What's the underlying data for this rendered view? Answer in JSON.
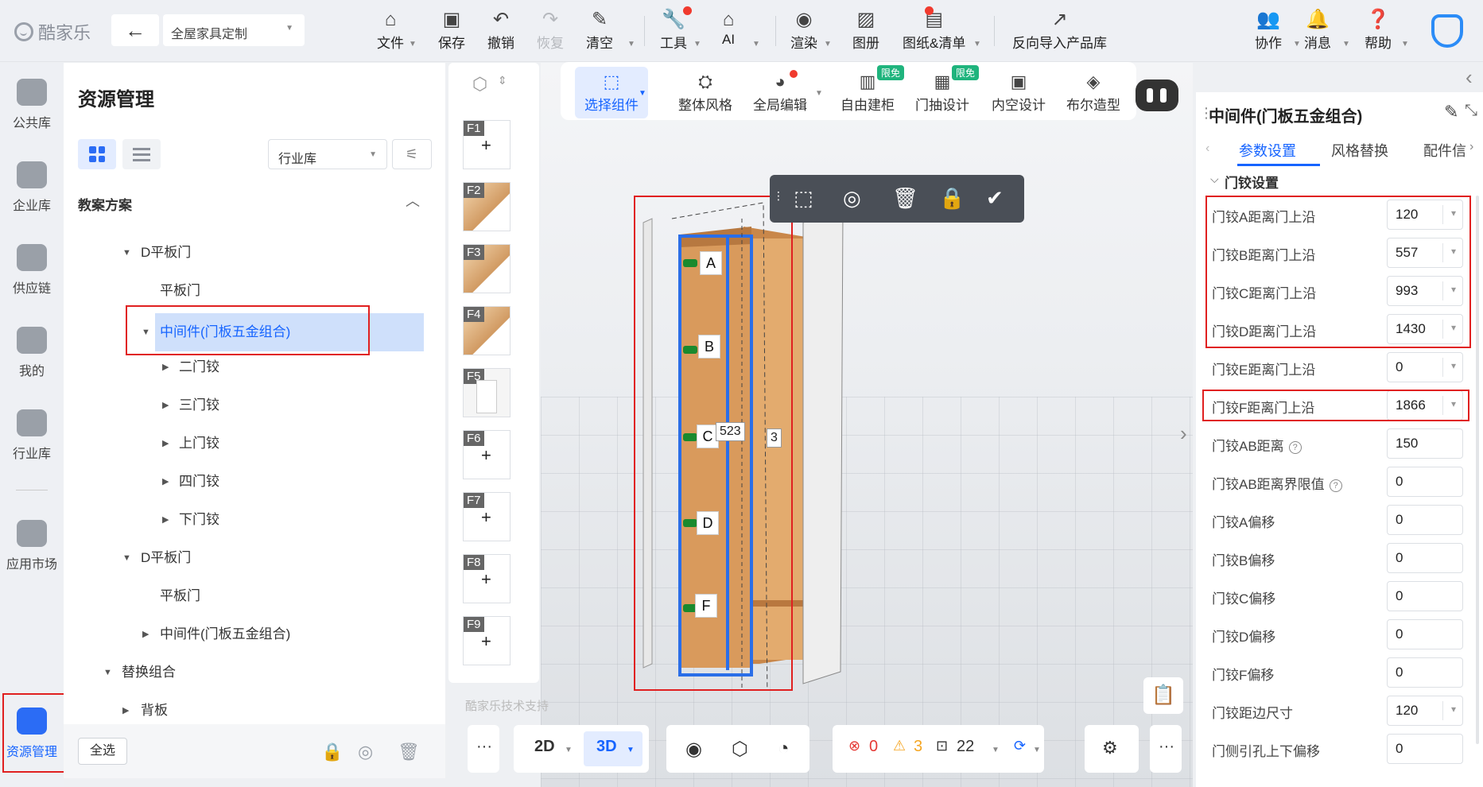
{
  "app": {
    "logo_text": "酷家乐",
    "project_name": "全屋家具定制"
  },
  "toolbar": {
    "file": "文件",
    "save": "保存",
    "undo": "撤销",
    "redo": "恢复",
    "clear": "清空",
    "tools": "工具",
    "ai": "AI",
    "render": "渲染",
    "album": "图册",
    "drawings": "图纸&清单",
    "reverse_import": "反向导入产品库",
    "collab": "协作",
    "message": "消息",
    "help": "帮助"
  },
  "left_nav": [
    "公共库",
    "企业库",
    "供应链",
    "我的",
    "行业库",
    "应用市场",
    "资源管理"
  ],
  "resource_panel": {
    "title": "资源管理",
    "library_select": "行业库",
    "section": "教案方案",
    "tree": [
      {
        "label": "D平板门"
      },
      {
        "label": "平板门"
      },
      {
        "label": "中间件(门板五金组合)"
      },
      {
        "label": "二门铰"
      },
      {
        "label": "三门铰"
      },
      {
        "label": "上门铰"
      },
      {
        "label": "四门铰"
      },
      {
        "label": "下门铰"
      },
      {
        "label": "D平板门"
      },
      {
        "label": "平板门"
      },
      {
        "label": "中间件(门板五金组合)"
      },
      {
        "label": "替换组合"
      },
      {
        "label": "背板"
      }
    ],
    "select_all": "全选"
  },
  "thumbs": [
    "F1",
    "F2",
    "F3",
    "F4",
    "F5",
    "F6",
    "F7",
    "F8",
    "F9"
  ],
  "mode_bar": {
    "select": "选择组件",
    "style": "整体风格",
    "global_edit": "全局编辑",
    "free_build": "自由建柜",
    "door_design": "门抽设计",
    "interior": "内空设计",
    "boolean": "布尔造型",
    "badge": "限免"
  },
  "canvas": {
    "hinge_labels": [
      "A",
      "B",
      "C",
      "D",
      "F"
    ],
    "dim_width": "523",
    "dim_side": "3",
    "watermark": "酷家乐技术支持"
  },
  "bottom_bar": {
    "mode_2d": "2D",
    "mode_3d": "3D",
    "errors": "0",
    "warnings": "3",
    "count": "22"
  },
  "prop_panel": {
    "title": "中间件(门板五金组合)",
    "tabs": [
      "参数设置",
      "风格替换",
      "配件信"
    ],
    "section": "门铰设置",
    "rows": [
      {
        "label": "门铰A距离门上沿",
        "value": "120"
      },
      {
        "label": "门铰B距离门上沿",
        "value": "557"
      },
      {
        "label": "门铰C距离门上沿",
        "value": "993"
      },
      {
        "label": "门铰D距离门上沿",
        "value": "1430"
      },
      {
        "label": "门铰E距离门上沿",
        "value": "0"
      },
      {
        "label": "门铰F距离门上沿",
        "value": "1866"
      },
      {
        "label": "门铰AB距离",
        "value": "150"
      },
      {
        "label": "门铰AB距离界限值",
        "value": "0"
      },
      {
        "label": "门铰A偏移",
        "value": "0"
      },
      {
        "label": "门铰B偏移",
        "value": "0"
      },
      {
        "label": "门铰C偏移",
        "value": "0"
      },
      {
        "label": "门铰D偏移",
        "value": "0"
      },
      {
        "label": "门铰F偏移",
        "value": "0"
      },
      {
        "label": "门铰距边尺寸",
        "value": "120"
      },
      {
        "label": "门侧引孔上下偏移",
        "value": "0"
      }
    ]
  }
}
